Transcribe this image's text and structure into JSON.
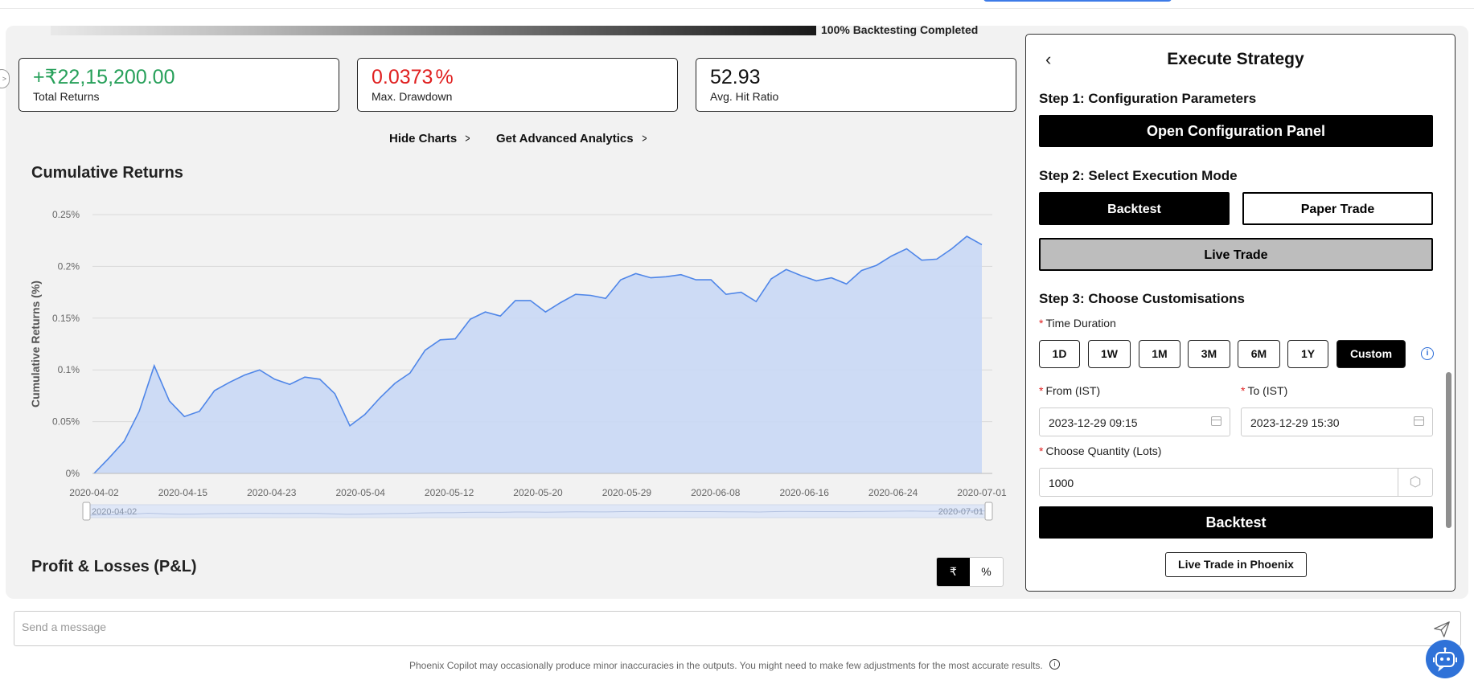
{
  "progress": {
    "label": "100% Backtesting Completed",
    "value_percent": 100
  },
  "stats": [
    {
      "value": "+₹22,15,200.00",
      "label": "Total Returns",
      "color": "#27a05a"
    },
    {
      "value": "0.0373",
      "unit": "%",
      "label": "Max. Drawdown",
      "color": "#e02020"
    },
    {
      "value": "52.93",
      "label": "Avg. Hit Ratio",
      "color": "#222222"
    }
  ],
  "links": {
    "hide_charts": "Hide Charts",
    "advanced_analytics": "Get Advanced Analytics"
  },
  "chart_title": "Cumulative Returns",
  "chart_data": {
    "type": "area",
    "title": "Cumulative Returns",
    "xlabel": "",
    "ylabel": "Cumulative Returns (%)",
    "ylim": [
      0,
      0.25
    ],
    "y_ticks": [
      "0%",
      "0.05%",
      "0.1%",
      "0.15%",
      "0.2%",
      "0.25%"
    ],
    "x_ticks": [
      "2020-04-02",
      "2020-04-15",
      "2020-04-23",
      "2020-05-04",
      "2020-05-12",
      "2020-05-20",
      "2020-05-29",
      "2020-06-08",
      "2020-06-16",
      "2020-06-24",
      "2020-07-01"
    ],
    "range_slider": {
      "start": "2020-04-02",
      "end": "2020-07-01"
    },
    "grid": true,
    "color": "#4f86e8",
    "values": [
      0,
      0.015,
      0.031,
      0.06,
      0.104,
      0.07,
      0.055,
      0.06,
      0.08,
      0.088,
      0.095,
      0.1,
      0.091,
      0.086,
      0.093,
      0.091,
      0.077,
      0.046,
      0.057,
      0.073,
      0.087,
      0.097,
      0.119,
      0.129,
      0.13,
      0.149,
      0.156,
      0.152,
      0.167,
      0.167,
      0.156,
      0.165,
      0.173,
      0.172,
      0.169,
      0.187,
      0.193,
      0.189,
      0.19,
      0.192,
      0.187,
      0.187,
      0.173,
      0.175,
      0.166,
      0.188,
      0.197,
      0.191,
      0.186,
      0.189,
      0.183,
      0.196,
      0.201,
      0.21,
      0.217,
      0.206,
      0.207,
      0.217,
      0.229,
      0.221
    ]
  },
  "pl": {
    "title": "Profit & Losses (P&L)",
    "toggle": [
      "₹",
      "%"
    ],
    "selected": "₹"
  },
  "execute": {
    "title": "Execute Strategy",
    "step1": "Step 1: Configuration Parameters",
    "open_config": "Open Configuration Panel",
    "step2": "Step 2: Select Execution Mode",
    "modes": [
      "Backtest",
      "Paper Trade",
      "Live Trade"
    ],
    "selected_mode": "Backtest",
    "step3": "Step 3: Choose Customisations",
    "time_duration_label": "Time Duration",
    "durations": [
      "1D",
      "1W",
      "1M",
      "3M",
      "6M",
      "1Y",
      "Custom"
    ],
    "selected_duration": "Custom",
    "from_label": "From (IST)",
    "from_value": "2023-12-29 09:15",
    "to_label": "To (IST)",
    "to_value": "2023-12-29 15:30",
    "qty_label": "Choose Quantity (Lots)",
    "qty_value": "1000",
    "run_button": "Backtest",
    "live_phoenix": "Live Trade in Phoenix"
  },
  "message": {
    "placeholder": "Send a message"
  },
  "disclaimer": "Phoenix Copilot may occasionally produce minor inaccuracies in the outputs. You might need to make few adjustments for the most accurate results."
}
